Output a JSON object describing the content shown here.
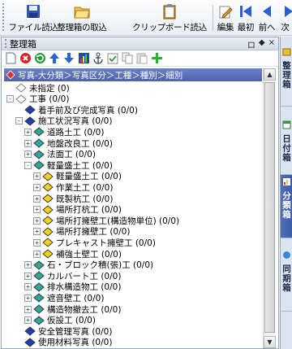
{
  "toolbar": {
    "buttons": [
      {
        "label": "ファイル読込",
        "icon": "save-disk-icon"
      },
      {
        "label": "整理箱の取込",
        "icon": "open-folder-icon"
      },
      {
        "label": "クリップボード読込",
        "icon": "clipboard-icon"
      },
      {
        "label": "編集",
        "icon": "edit-pencil-icon"
      },
      {
        "label": "最初",
        "icon": "first-arrow-icon"
      },
      {
        "label": "前へ",
        "icon": "prev-arrow-icon"
      },
      {
        "label": "次",
        "icon": "next-arrow-icon"
      }
    ]
  },
  "panel": {
    "title": "整理箱",
    "controls": [
      "ロ",
      "◆",
      "×"
    ],
    "tools": [
      "new-doc-icon",
      "delete-icon",
      "refresh-icon",
      "up-arrow-icon",
      "down-arrow-icon",
      "chart-icon",
      "anchor-icon",
      "checkbox-icon",
      "copy-icon",
      "paste-icon",
      "add-icon"
    ]
  },
  "path": "写真-大分類＞写真区分＞工種＞種別＞細別",
  "tree": [
    {
      "label": "未指定 (0)",
      "level": 0,
      "toggle": "",
      "icon": "white"
    },
    {
      "label": "工事 (0/0)",
      "level": 0,
      "toggle": "-",
      "icon": "white"
    },
    {
      "label": "着手前及び完成写真 (0/0)",
      "level": 1,
      "toggle": "",
      "icon": "blue"
    },
    {
      "label": "施工状況写真 (0/0)",
      "level": 1,
      "toggle": "-",
      "icon": "blue"
    },
    {
      "label": "道路土工 (0/0)",
      "level": 2,
      "toggle": "+",
      "icon": "teal"
    },
    {
      "label": "地盤改良工 (0/0)",
      "level": 2,
      "toggle": "+",
      "icon": "teal"
    },
    {
      "label": "法面工 (0/0)",
      "level": 2,
      "toggle": "+",
      "icon": "teal"
    },
    {
      "label": "軽量盛土工 (0/0)",
      "level": 2,
      "toggle": "-",
      "icon": "teal"
    },
    {
      "label": "軽量盛土工 (0/0)",
      "level": 3,
      "toggle": "+",
      "icon": "yellow"
    },
    {
      "label": "作業土工 (0/0)",
      "level": 3,
      "toggle": "+",
      "icon": "yellow"
    },
    {
      "label": "既製杭工 (0/0)",
      "level": 3,
      "toggle": "+",
      "icon": "yellow"
    },
    {
      "label": "場所打杭工 (0/0)",
      "level": 3,
      "toggle": "+",
      "icon": "yellow"
    },
    {
      "label": "場所打擁壁工(構造物単位) (0/0)",
      "level": 3,
      "toggle": "+",
      "icon": "yellow"
    },
    {
      "label": "場所打擁壁工 (0/0)",
      "level": 3,
      "toggle": "+",
      "icon": "yellow"
    },
    {
      "label": "プレキャスト擁壁工 (0/0)",
      "level": 3,
      "toggle": "+",
      "icon": "yellow"
    },
    {
      "label": "補強土壁工 (0/0)",
      "level": 3,
      "toggle": "+",
      "icon": "yellow"
    },
    {
      "label": "石・ブロック積(張)工 (0/0)",
      "level": 2,
      "toggle": "+",
      "icon": "teal"
    },
    {
      "label": "カルバート工 (0/0)",
      "level": 2,
      "toggle": "+",
      "icon": "teal"
    },
    {
      "label": "排水構造物工 (0/0)",
      "level": 2,
      "toggle": "+",
      "icon": "teal"
    },
    {
      "label": "遮音壁工 (0/0)",
      "level": 2,
      "toggle": "+",
      "icon": "teal"
    },
    {
      "label": "構造物撤去工 (0/0)",
      "level": 2,
      "toggle": "+",
      "icon": "teal"
    },
    {
      "label": "仮設工 (0/0)",
      "level": 2,
      "toggle": "+",
      "icon": "teal"
    },
    {
      "label": "安全管理写真 (0/0)",
      "level": 1,
      "toggle": "",
      "icon": "blue"
    },
    {
      "label": "使用材料写真 (0/0)",
      "level": 1,
      "toggle": "",
      "icon": "blue"
    }
  ],
  "side_tabs": [
    {
      "label": "整理箱",
      "icon": "box-icon",
      "active": false
    },
    {
      "label": "日付箱",
      "icon": "calendar-icon",
      "active": false
    },
    {
      "label": "分類箱",
      "icon": "category-icon",
      "active": true
    },
    {
      "label": "同期箱",
      "icon": "sync-icon",
      "active": false
    }
  ],
  "colors": {
    "white": "#ffffff",
    "blue": "#1d3fb8",
    "teal": "#2fa7a0",
    "yellow": "#f2d21b",
    "path_bar": "#4d62ad"
  }
}
